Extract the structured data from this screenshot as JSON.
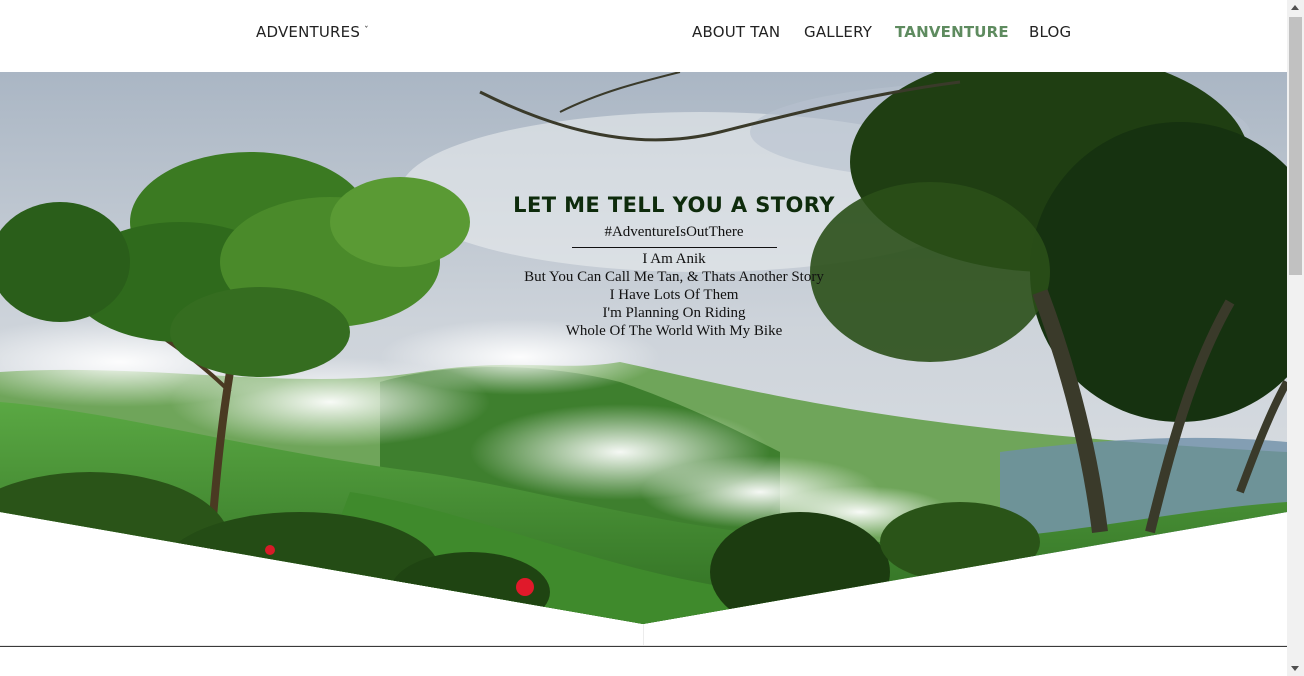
{
  "navbar": {
    "adventures_label": "ADVENTURES",
    "caret": "ˇ",
    "links": [
      {
        "label": "ABOUT TAN"
      },
      {
        "label": "GALLERY"
      },
      {
        "label": "TANVENTURE"
      },
      {
        "label": "BLOG"
      }
    ],
    "active_color": "#5e8b5f"
  },
  "hero": {
    "title": "LET ME TELL YOU A STORY",
    "hashtag": "#AdventureIsOutThere",
    "lines": [
      "I Am Anik",
      "But You Can Call Me Tan, & Thats Another Story",
      "I Have Lots Of Them",
      "I'm Planning On Riding",
      "Whole Of The World With My Bike"
    ]
  },
  "colors": {
    "sky": "#c9d0d8",
    "hills": "#4f9a3a",
    "foliage": "#2e5a1e",
    "cloud": "#f4f4f2"
  }
}
